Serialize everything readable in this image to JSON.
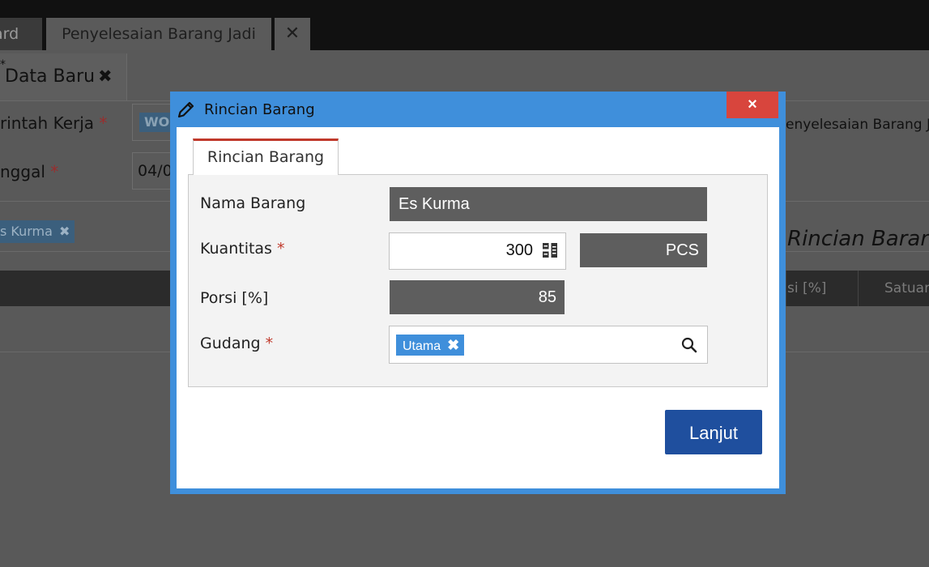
{
  "top_tabs": {
    "dashboard_partial": "ard",
    "finishing": "Penyelesaian Barang Jadi",
    "close": "✕"
  },
  "sub_tab": {
    "star": "*",
    "label": "Data Baru",
    "close": "✖"
  },
  "background_form": {
    "work_order_label": "rintah Kerja",
    "work_order_chip": "WO",
    "date_label": "nggal",
    "date_value": "04/0",
    "required_mark": "*",
    "right_text": "enyelesaian Barang Ja",
    "item_tag": "s Kurma",
    "item_tag_close": "✖",
    "section_title": "Rincian Baran",
    "table_headers": [
      "si [%]",
      "Satuar"
    ]
  },
  "dialog": {
    "title": "Rincian Barang",
    "close": "×",
    "tab_label": "Rincian Barang",
    "required_mark": "*",
    "fields": {
      "item_name_label": "Nama Barang",
      "item_name_value": "Es Kurma",
      "quantity_label": "Kuantitas",
      "quantity_value": "300",
      "unit_value": "PCS",
      "portion_label": "Porsi [%]",
      "portion_value": "85",
      "warehouse_label": "Gudang",
      "warehouse_tag": "Utama",
      "warehouse_tag_close": "✖"
    },
    "next_button": "Lanjut"
  },
  "colors": {
    "dialog_border": "#3f8fdb",
    "close_button": "#d8453d",
    "primary_button": "#1f4f9e",
    "tag": "#3f8fdb",
    "readonly_field": "#5e5e5e",
    "required": "#c0392b"
  },
  "icons": [
    "pencil-icon",
    "calculator-icon",
    "search-icon",
    "close-icon"
  ]
}
